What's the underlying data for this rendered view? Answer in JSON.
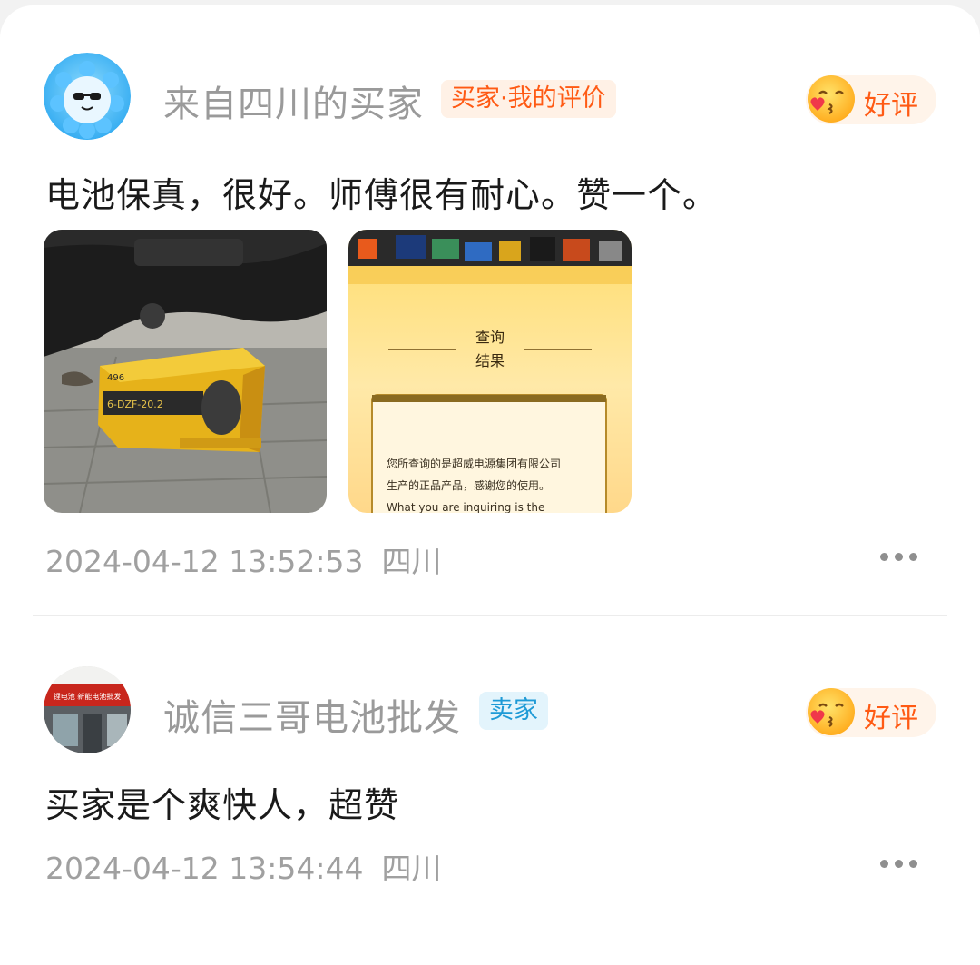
{
  "reviews": [
    {
      "user_name": "来自四川的买家",
      "role_tag": "买家·我的评价",
      "rating_label": "好评",
      "content": "电池保真，很好。师傅很有耐心。赞一个。",
      "images": [
        {
          "alt": "电池包装箱照片",
          "box_text_1": "496",
          "box_text_2": "6-DZF-20.2"
        },
        {
          "alt": "查询结果截图",
          "header_title_line1": "查询",
          "header_title_line2": "结果",
          "result_line1": "您所查询的是超威电源集团有限公司",
          "result_line2": "生产的正品产品，感谢您的使用。",
          "result_line3": "What you are inquiring is the"
        }
      ],
      "timestamp": "2024-04-12 13:52:53",
      "location": "四川",
      "colors": {
        "tag_bg": "#fff1e6",
        "tag_fg": "#ff5a14"
      }
    },
    {
      "user_name": "诚信三哥电池批发",
      "role_tag": "卖家",
      "rating_label": "好评",
      "content": "买家是个爽快人，超赞",
      "avatar_sign_text": "锂电池 新能电池批发",
      "timestamp": "2024-04-12 13:54:44",
      "location": "四川",
      "colors": {
        "tag_bg": "#e3f4fc",
        "tag_fg": "#1e9ad6"
      }
    }
  ],
  "icons": {
    "rating": "kissing-face-emoji-icon",
    "more": "more-dots-icon"
  }
}
